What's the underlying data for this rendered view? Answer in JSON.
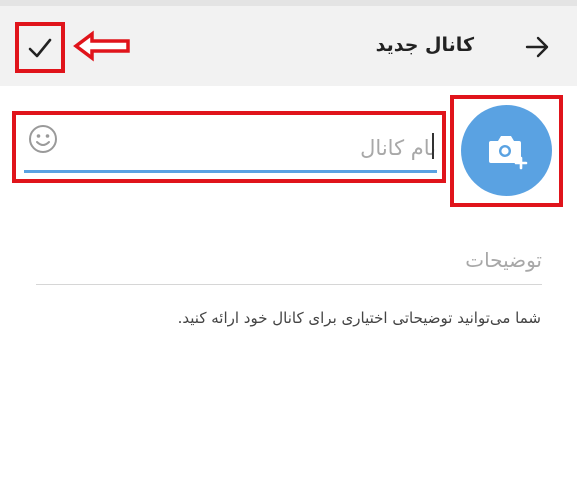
{
  "app_bar": {
    "title": "کانال جدید",
    "back_icon": "arrow-right-icon",
    "confirm_icon": "check-icon"
  },
  "form": {
    "avatar_icon": "add-photo-camera-icon",
    "channel_name": {
      "placeholder": "نام کانال",
      "value": ""
    },
    "emoji_icon": "smiley-icon",
    "description": {
      "placeholder": "توضیحات",
      "value": ""
    },
    "description_hint": "شما می‌توانید توضیحاتی اختیاری برای کانال خود ارائه کنید."
  },
  "colors": {
    "accent": "#5aa2e2",
    "highlight": "#e0141b",
    "appbar": "#f2f2f2"
  }
}
